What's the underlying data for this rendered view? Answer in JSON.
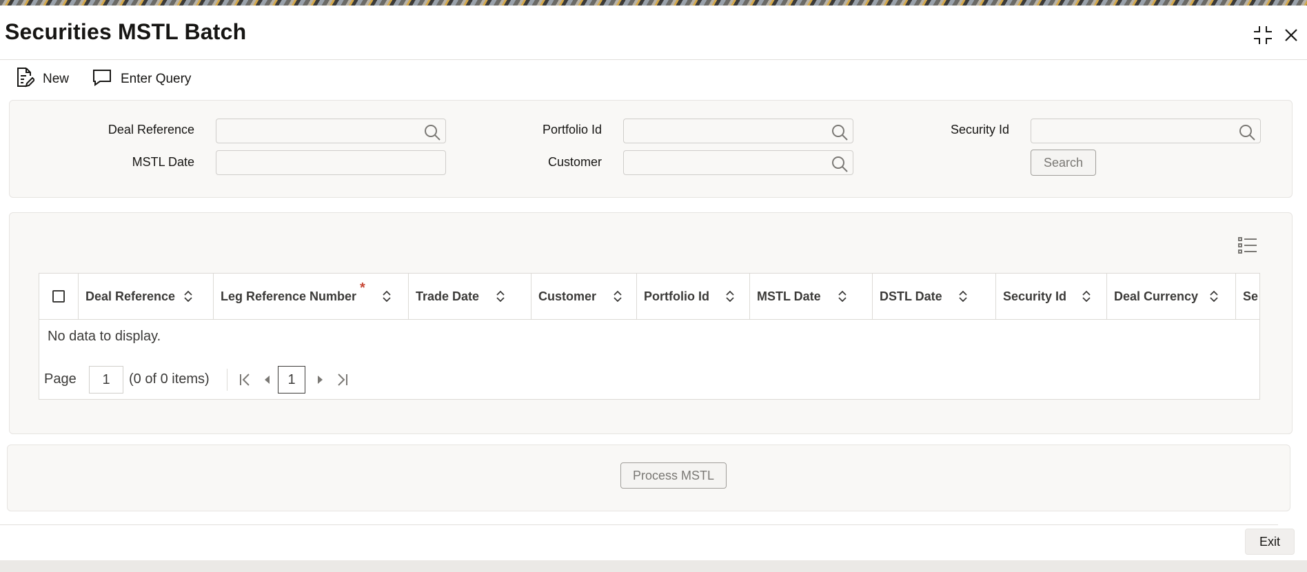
{
  "window": {
    "title": "Securities MSTL Batch",
    "icons": {
      "restore": "collapse-arrows-icon",
      "close": "close-icon"
    }
  },
  "toolbar": {
    "new_label": "New",
    "enter_query_label": "Enter Query"
  },
  "search": {
    "deal_reference_label": "Deal Reference",
    "deal_reference_value": "",
    "mstl_date_label": "MSTL Date",
    "mstl_date_value": "",
    "portfolio_id_label": "Portfolio Id",
    "portfolio_id_value": "",
    "customer_label": "Customer",
    "customer_value": "",
    "security_id_label": "Security Id",
    "security_id_value": "",
    "search_button": "Search"
  },
  "grid": {
    "columns": [
      "Deal Reference",
      "Leg Reference Number",
      "Trade Date",
      "Customer",
      "Portfolio Id",
      "MSTL Date",
      "DSTL Date",
      "Security Id",
      "Deal Currency",
      "Se"
    ],
    "required_marker": "*",
    "empty_message": "No data to display.",
    "pager": {
      "page_label": "Page",
      "page_value": "1",
      "items_text": "(0 of 0 items)",
      "current_page": "1"
    }
  },
  "actions": {
    "process_label": "Process MSTL",
    "exit_label": "Exit"
  },
  "colors": {
    "accent_required": "#c74634",
    "text": "#161513",
    "panel_bg": "#f9f8f6"
  }
}
